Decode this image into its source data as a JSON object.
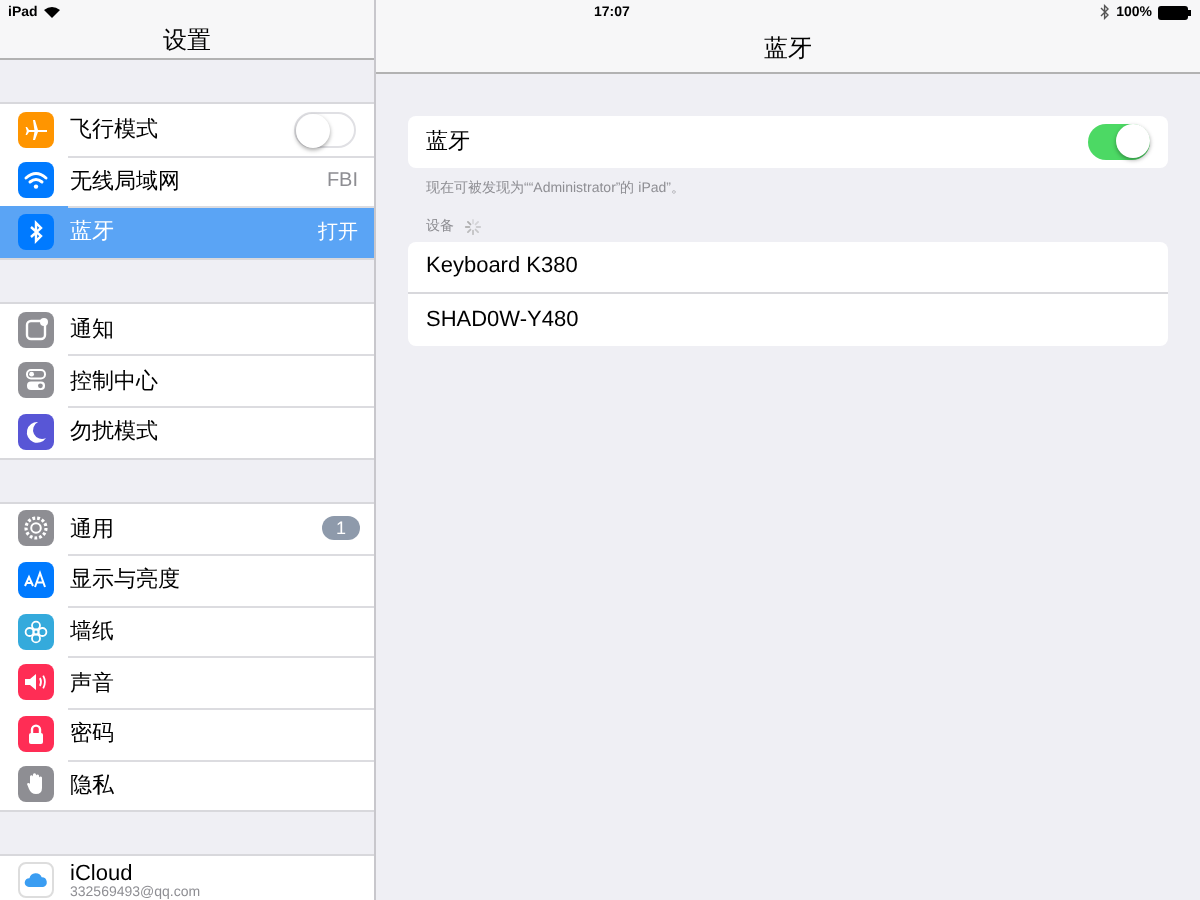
{
  "status_bar": {
    "device": "iPad",
    "time": "17:07",
    "battery": "100%"
  },
  "sidebar": {
    "title": "设置",
    "groups": [
      {
        "items": [
          {
            "kind": "toggle",
            "label": "飞行模式",
            "on": false,
            "selected": false
          },
          {
            "kind": "value",
            "label": "无线局域网",
            "value": "FBI",
            "selected": false
          },
          {
            "kind": "value",
            "label": "蓝牙",
            "value": "打开",
            "selected": true
          }
        ]
      },
      {
        "items": [
          {
            "kind": "plain",
            "label": "通知",
            "selected": false
          },
          {
            "kind": "plain",
            "label": "控制中心",
            "selected": false
          },
          {
            "kind": "plain",
            "label": "勿扰模式",
            "selected": false
          }
        ]
      },
      {
        "items": [
          {
            "kind": "badge",
            "label": "通用",
            "badge": "1",
            "selected": false
          },
          {
            "kind": "plain",
            "label": "显示与亮度",
            "selected": false
          },
          {
            "kind": "plain",
            "label": "墙纸",
            "selected": false
          },
          {
            "kind": "plain",
            "label": "声音",
            "selected": false
          },
          {
            "kind": "plain",
            "label": "密码",
            "selected": false
          },
          {
            "kind": "plain",
            "label": "隐私",
            "selected": false
          }
        ]
      },
      {
        "items": [
          {
            "kind": "account",
            "label": "iCloud",
            "subtitle": "332569493@qq.com",
            "selected": false
          }
        ]
      }
    ]
  },
  "detail": {
    "title": "蓝牙",
    "toggle": {
      "label": "蓝牙",
      "on": true
    },
    "caption": "现在可被发现为““Administrator”的 iPad”。",
    "section_label": "设备",
    "devices": [
      "Keyboard K380",
      "SHAD0W-Y480"
    ]
  }
}
